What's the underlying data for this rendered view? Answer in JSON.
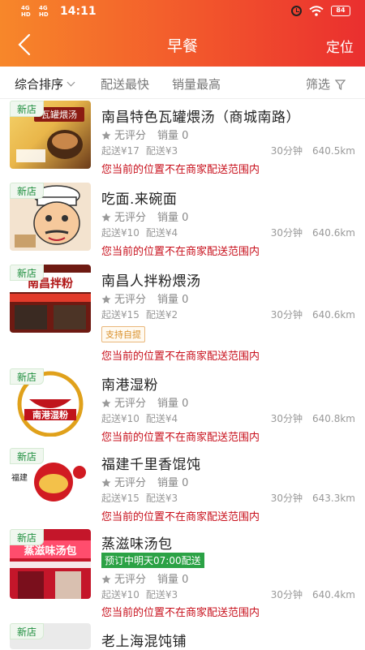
{
  "status": {
    "sig1": "4G HD",
    "sig2": "4G HD",
    "time": "14:11",
    "battery": "84"
  },
  "header": {
    "title": "早餐",
    "locate": "定位"
  },
  "sort": {
    "items": [
      "综合排序",
      "配送最快",
      "销量最高"
    ],
    "filter": "筛选"
  },
  "shops": [
    {
      "badge": "新店",
      "name": "南昌特色瓦罐煨汤（商城南路）",
      "rating": "无评分",
      "sales": "销量 0",
      "min_fee": "起送¥17",
      "delivery_fee": "配送¥3",
      "time": "30分钟",
      "distance": "640.5km",
      "warning": "您当前的位置不在商家配送范围内",
      "thumb_text": "瓦罐煨汤"
    },
    {
      "badge": "新店",
      "name": "吃面.来碗面",
      "rating": "无评分",
      "sales": "销量 0",
      "min_fee": "起送¥10",
      "delivery_fee": "配送¥4",
      "time": "30分钟",
      "distance": "640.6km",
      "warning": "您当前的位置不在商家配送范围内",
      "thumb_text": ""
    },
    {
      "badge": "新店",
      "name": "南昌人拌粉煨汤",
      "rating": "无评分",
      "sales": "销量 0",
      "min_fee": "起送¥15",
      "delivery_fee": "配送¥2",
      "time": "30分钟",
      "distance": "640.6km",
      "tag": "支持自提",
      "warning": "您当前的位置不在商家配送范围内",
      "thumb_text": "南昌拌粉"
    },
    {
      "badge": "新店",
      "name": "南港湿粉",
      "rating": "无评分",
      "sales": "销量 0",
      "min_fee": "起送¥10",
      "delivery_fee": "配送¥4",
      "time": "30分钟",
      "distance": "640.8km",
      "warning": "您当前的位置不在商家配送范围内",
      "thumb_text": "南港湿粉"
    },
    {
      "badge": "新店",
      "name": "福建千里香馄饨",
      "rating": "无评分",
      "sales": "销量 0",
      "min_fee": "起送¥15",
      "delivery_fee": "配送¥3",
      "time": "30分钟",
      "distance": "643.3km",
      "warning": "您当前的位置不在商家配送范围内",
      "thumb_text": "福建"
    },
    {
      "badge": "新店",
      "name": "蒸滋味汤包",
      "preorder": "预订中明天07:00配送",
      "rating": "无评分",
      "sales": "销量 0",
      "min_fee": "起送¥10",
      "delivery_fee": "配送¥3",
      "time": "30分钟",
      "distance": "640.4km",
      "warning": "您当前的位置不在商家配送范围内",
      "thumb_text": "蒸滋味汤包"
    },
    {
      "badge": "新店",
      "name": "老上海混饨铺"
    }
  ],
  "colors": {
    "accent": "#f2562c",
    "warning": "#c8101c",
    "badge_green": "#1e8e3e",
    "preorder_green": "#2ba245"
  },
  "icons": [
    "back-arrow-icon",
    "alarm-icon",
    "wifi-icon",
    "battery-icon",
    "chevron-down-icon",
    "filter-funnel-icon",
    "star-icon"
  ]
}
